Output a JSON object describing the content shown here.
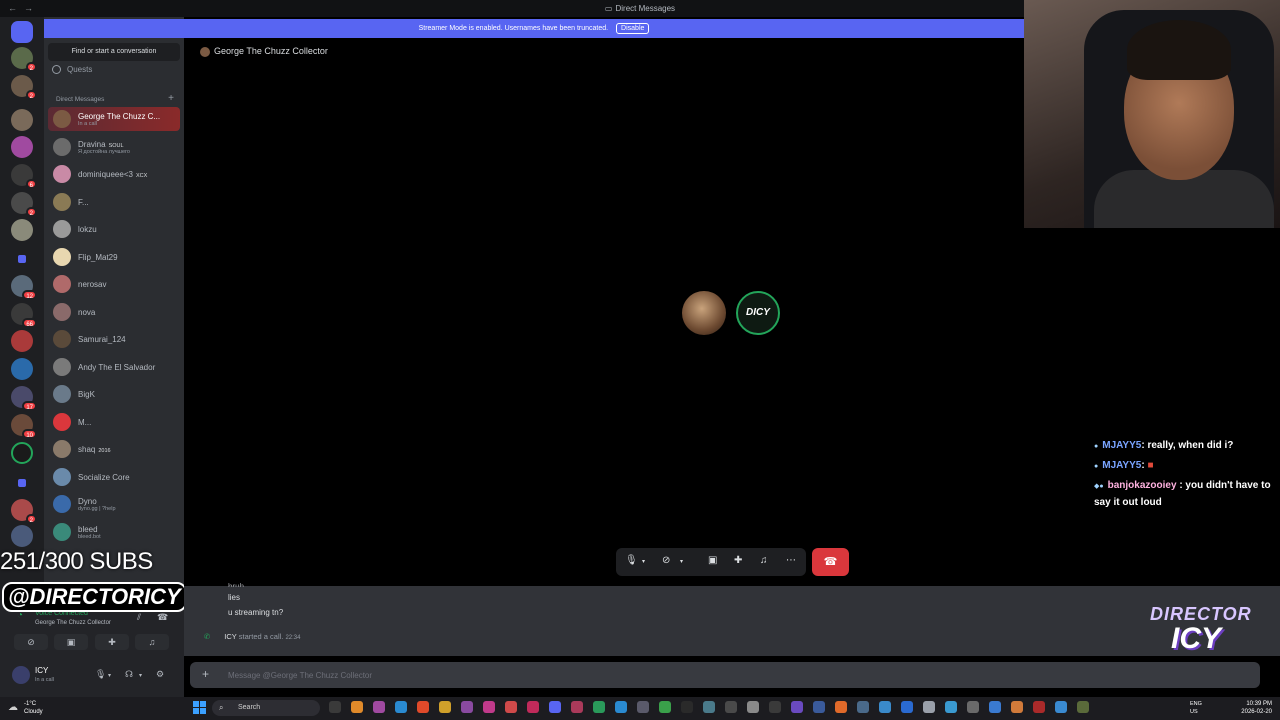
{
  "window": {
    "title": "Direct Messages",
    "nav_back": "←",
    "nav_forward": "→"
  },
  "banner": {
    "text": "Streamer Mode is enabled. Usernames have been truncated.",
    "button": "Disable"
  },
  "sidebar": {
    "search_label": "Find or start a conversation",
    "quests_label": "Quests",
    "dm_header": "Direct Messages",
    "add_dm": "+",
    "dms": [
      {
        "name": "George The Chuzz C...",
        "sub": "In a call",
        "active": true,
        "color": "#7b5a43"
      },
      {
        "name": "Dravina",
        "tag": "SOUL",
        "sub": "Я достойна лучшего",
        "color": "#6b6b6b"
      },
      {
        "name": "dominiqueee<3",
        "tag": "XCX",
        "color": "#c98aa6"
      },
      {
        "name": "F...",
        "color": "#8a7a55"
      },
      {
        "name": "lokzu",
        "color": "#9a9a9a"
      },
      {
        "name": "Flip_Mat29",
        "color": "#e8d7b0"
      },
      {
        "name": "nerosav",
        "color": "#b06a6a"
      },
      {
        "name": "nova",
        "color": "#8a6a6a"
      },
      {
        "name": "Samurai_124",
        "color": "#5a4a3a"
      },
      {
        "name": "Andy The El Salvador",
        "color": "#7a7a7a"
      },
      {
        "name": "BigK",
        "color": "#6a7a8a"
      },
      {
        "name": "M...",
        "color": "#da373c"
      },
      {
        "name": "shaq",
        "tag": "2016",
        "color": "#8a7a6a"
      },
      {
        "name": "Socialize Core",
        "color": "#6a8aaa"
      },
      {
        "name": "Dyno",
        "sub": "dyno.gg | ?help",
        "color": "#3a6aaa"
      },
      {
        "name": "bleed",
        "sub": "bleed.bot",
        "color": "#3a8a7a"
      }
    ]
  },
  "servers": {
    "badges": [
      "2",
      "2",
      "6",
      "2",
      "12",
      "66",
      "17",
      "10",
      "2"
    ],
    "colors": {
      "home": "#5865f2",
      "folder": "#5865f2",
      "badge": "#f23f43"
    }
  },
  "voice_panel": {
    "status": "Voice Connected",
    "channel": "George The Chuzz Collector",
    "user_name": "ICY",
    "user_status": "In a call"
  },
  "overlay": {
    "subs": "251/300 SUBS",
    "handle": "@DIRECTORICY",
    "logo_line1": "DIRECTOR",
    "logo_line2": "ICY"
  },
  "channel": {
    "title": "George The Chuzz Collector"
  },
  "call": {
    "avatar2_text": "DICY",
    "hangup_icon": "phone-hangup"
  },
  "chat": {
    "partial": "bruh",
    "messages": [
      "lies",
      "u streaming tn?"
    ],
    "system_user": "ICY",
    "system_text": "started a call.",
    "system_time": "22:34",
    "composer_placeholder": "Message @George The Chuzz Collector"
  },
  "stream_chat": [
    {
      "user": "MJAYY5",
      "text": ": really, when did i?"
    },
    {
      "user": "MJAYY5",
      "text": ": "
    },
    {
      "user": "banjokazooiey",
      "text": ": you didn't have to say it out loud"
    }
  ],
  "taskbar": {
    "temp": "-1°C",
    "weather": "Cloudy",
    "search": "Search",
    "lang1": "ENG",
    "lang2": "US",
    "time": "10:39 PM",
    "date": "2026-02-20"
  },
  "colors": {
    "accent": "#5865f2",
    "online": "#23a55a",
    "danger": "#da373c"
  }
}
